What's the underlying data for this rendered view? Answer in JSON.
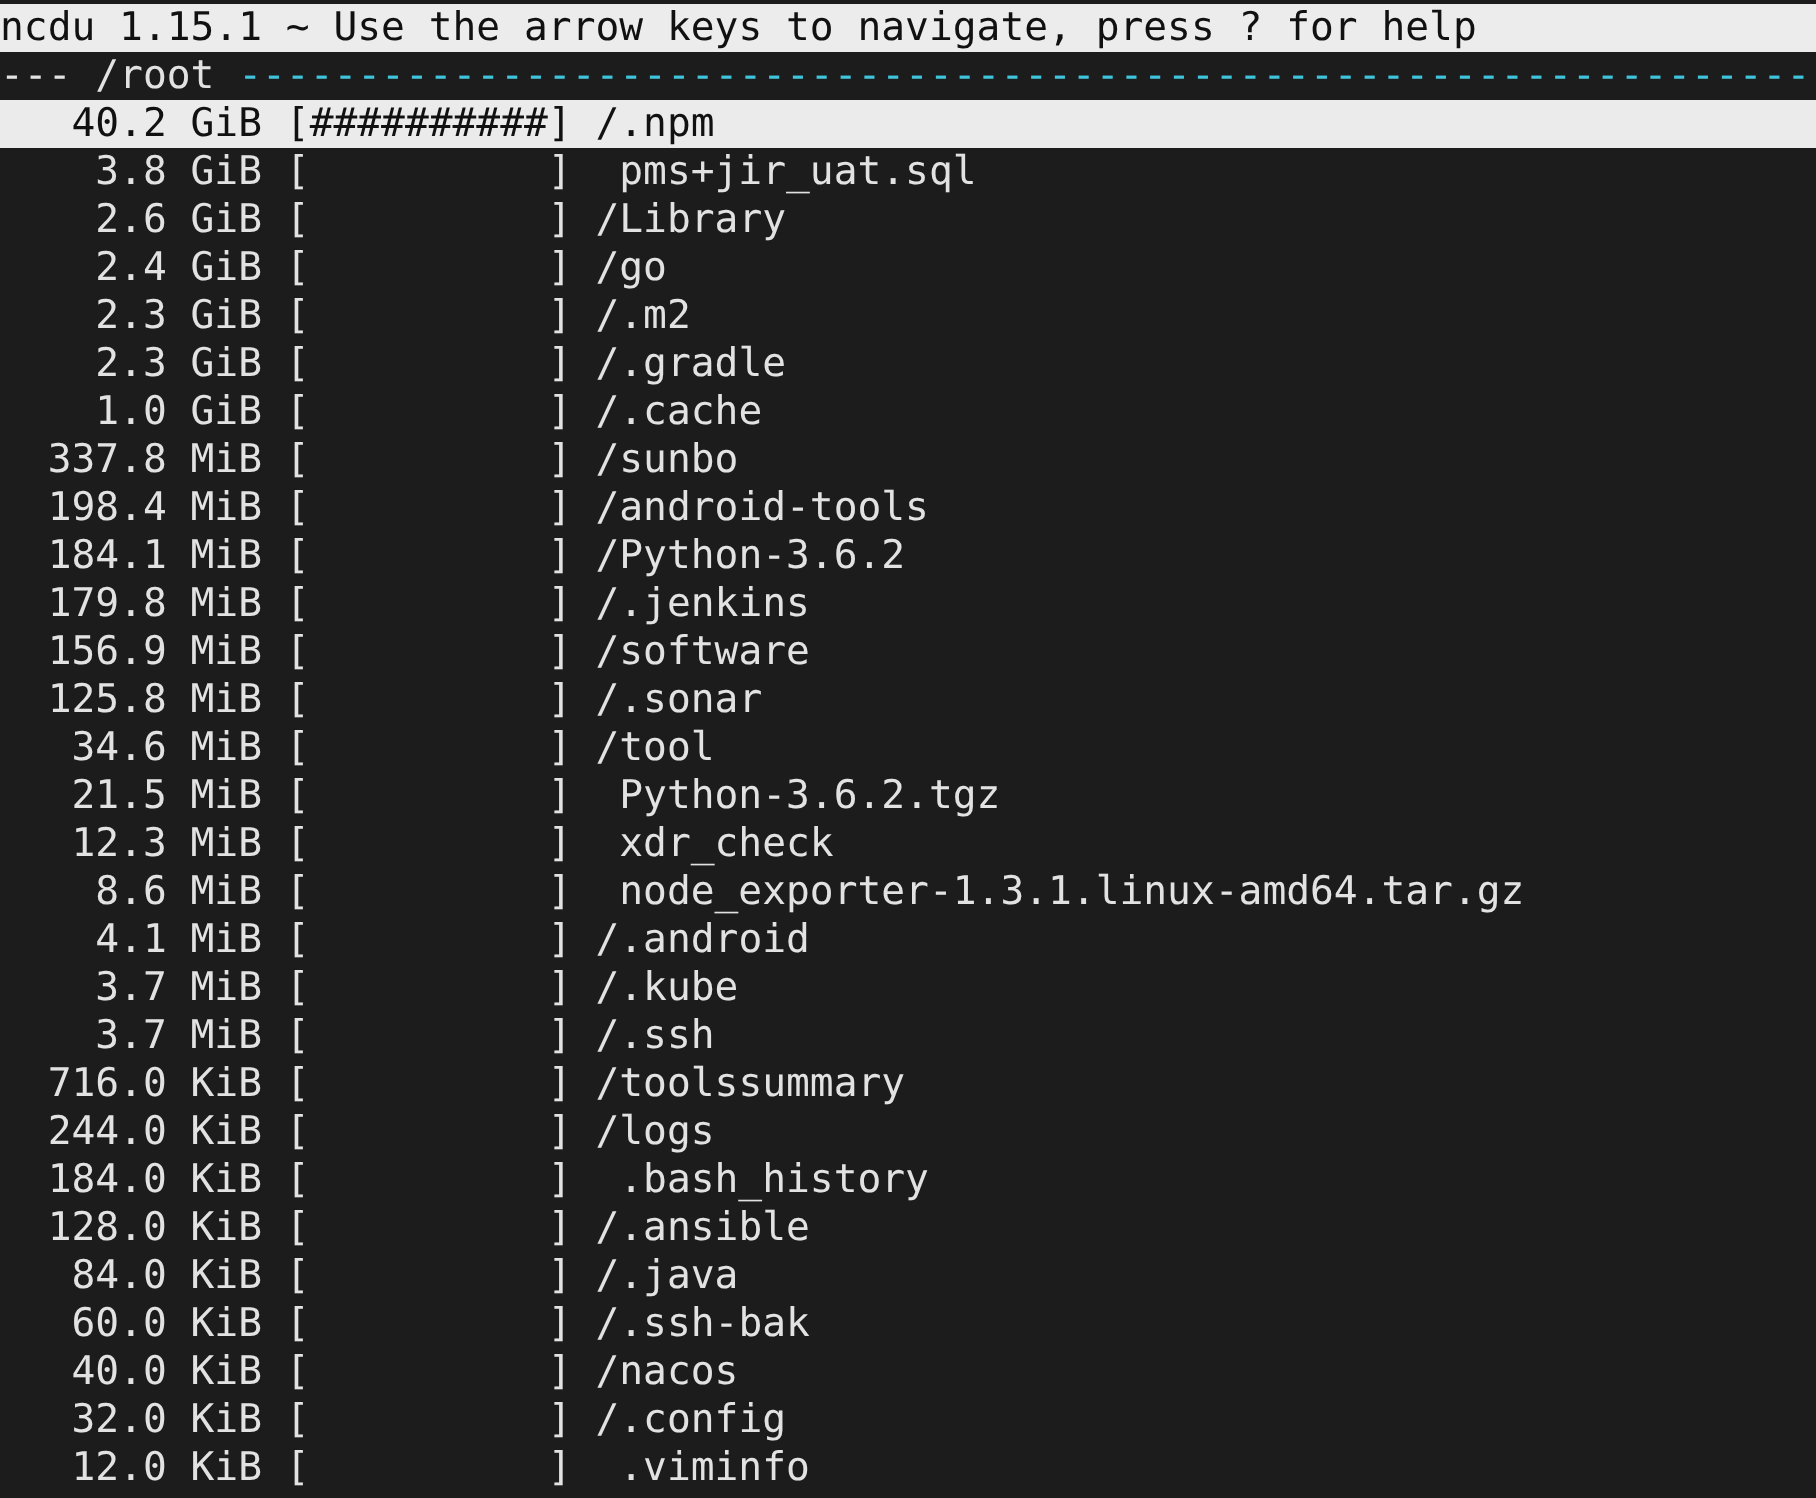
{
  "title_bar": {
    "text": "ncdu 1.15.1 ~ Use the arrow keys to navigate, press ? for help"
  },
  "path_bar": {
    "prefix": "---",
    "path": "/root",
    "rule": "------------------------------------------------------------------"
  },
  "rows": [
    {
      "size": "40.2 GiB",
      "graph": "[##########]",
      "name": "/.npm",
      "kind": "dir",
      "selected": true
    },
    {
      "size": "3.8 GiB",
      "graph": "[          ]",
      "name": "pms+jir_uat.sql",
      "kind": "file",
      "selected": false
    },
    {
      "size": "2.6 GiB",
      "graph": "[          ]",
      "name": "/Library",
      "kind": "dir",
      "selected": false
    },
    {
      "size": "2.4 GiB",
      "graph": "[          ]",
      "name": "/go",
      "kind": "dir",
      "selected": false
    },
    {
      "size": "2.3 GiB",
      "graph": "[          ]",
      "name": "/.m2",
      "kind": "dir",
      "selected": false
    },
    {
      "size": "2.3 GiB",
      "graph": "[          ]",
      "name": "/.gradle",
      "kind": "dir",
      "selected": false
    },
    {
      "size": "1.0 GiB",
      "graph": "[          ]",
      "name": "/.cache",
      "kind": "dir",
      "selected": false
    },
    {
      "size": "337.8 MiB",
      "graph": "[          ]",
      "name": "/sunbo",
      "kind": "dir",
      "selected": false
    },
    {
      "size": "198.4 MiB",
      "graph": "[          ]",
      "name": "/android-tools",
      "kind": "dir",
      "selected": false
    },
    {
      "size": "184.1 MiB",
      "graph": "[          ]",
      "name": "/Python-3.6.2",
      "kind": "dir",
      "selected": false
    },
    {
      "size": "179.8 MiB",
      "graph": "[          ]",
      "name": "/.jenkins",
      "kind": "dir",
      "selected": false
    },
    {
      "size": "156.9 MiB",
      "graph": "[          ]",
      "name": "/software",
      "kind": "dir",
      "selected": false
    },
    {
      "size": "125.8 MiB",
      "graph": "[          ]",
      "name": "/.sonar",
      "kind": "dir",
      "selected": false
    },
    {
      "size": "34.6 MiB",
      "graph": "[          ]",
      "name": "/tool",
      "kind": "dir",
      "selected": false
    },
    {
      "size": "21.5 MiB",
      "graph": "[          ]",
      "name": "Python-3.6.2.tgz",
      "kind": "file",
      "selected": false
    },
    {
      "size": "12.3 MiB",
      "graph": "[          ]",
      "name": "xdr_check",
      "kind": "file",
      "selected": false
    },
    {
      "size": "8.6 MiB",
      "graph": "[          ]",
      "name": "node_exporter-1.3.1.linux-amd64.tar.gz",
      "kind": "file",
      "selected": false
    },
    {
      "size": "4.1 MiB",
      "graph": "[          ]",
      "name": "/.android",
      "kind": "dir",
      "selected": false
    },
    {
      "size": "3.7 MiB",
      "graph": "[          ]",
      "name": "/.kube",
      "kind": "dir",
      "selected": false
    },
    {
      "size": "3.7 MiB",
      "graph": "[          ]",
      "name": "/.ssh",
      "kind": "dir",
      "selected": false
    },
    {
      "size": "716.0 KiB",
      "graph": "[          ]",
      "name": "/toolssummary",
      "kind": "dir",
      "selected": false
    },
    {
      "size": "244.0 KiB",
      "graph": "[          ]",
      "name": "/logs",
      "kind": "dir",
      "selected": false
    },
    {
      "size": "184.0 KiB",
      "graph": "[          ]",
      "name": ".bash_history",
      "kind": "file",
      "selected": false
    },
    {
      "size": "128.0 KiB",
      "graph": "[          ]",
      "name": "/.ansible",
      "kind": "dir",
      "selected": false
    },
    {
      "size": "84.0 KiB",
      "graph": "[          ]",
      "name": "/.java",
      "kind": "dir",
      "selected": false
    },
    {
      "size": "60.0 KiB",
      "graph": "[          ]",
      "name": "/.ssh-bak",
      "kind": "dir",
      "selected": false
    },
    {
      "size": "40.0 KiB",
      "graph": "[          ]",
      "name": "/nacos",
      "kind": "dir",
      "selected": false
    },
    {
      "size": "32.0 KiB",
      "graph": "[          ]",
      "name": "/.config",
      "kind": "dir",
      "selected": false
    },
    {
      "size": "12.0 KiB",
      "graph": "[          ]",
      "name": ".viminfo",
      "kind": "file",
      "selected": false
    }
  ]
}
